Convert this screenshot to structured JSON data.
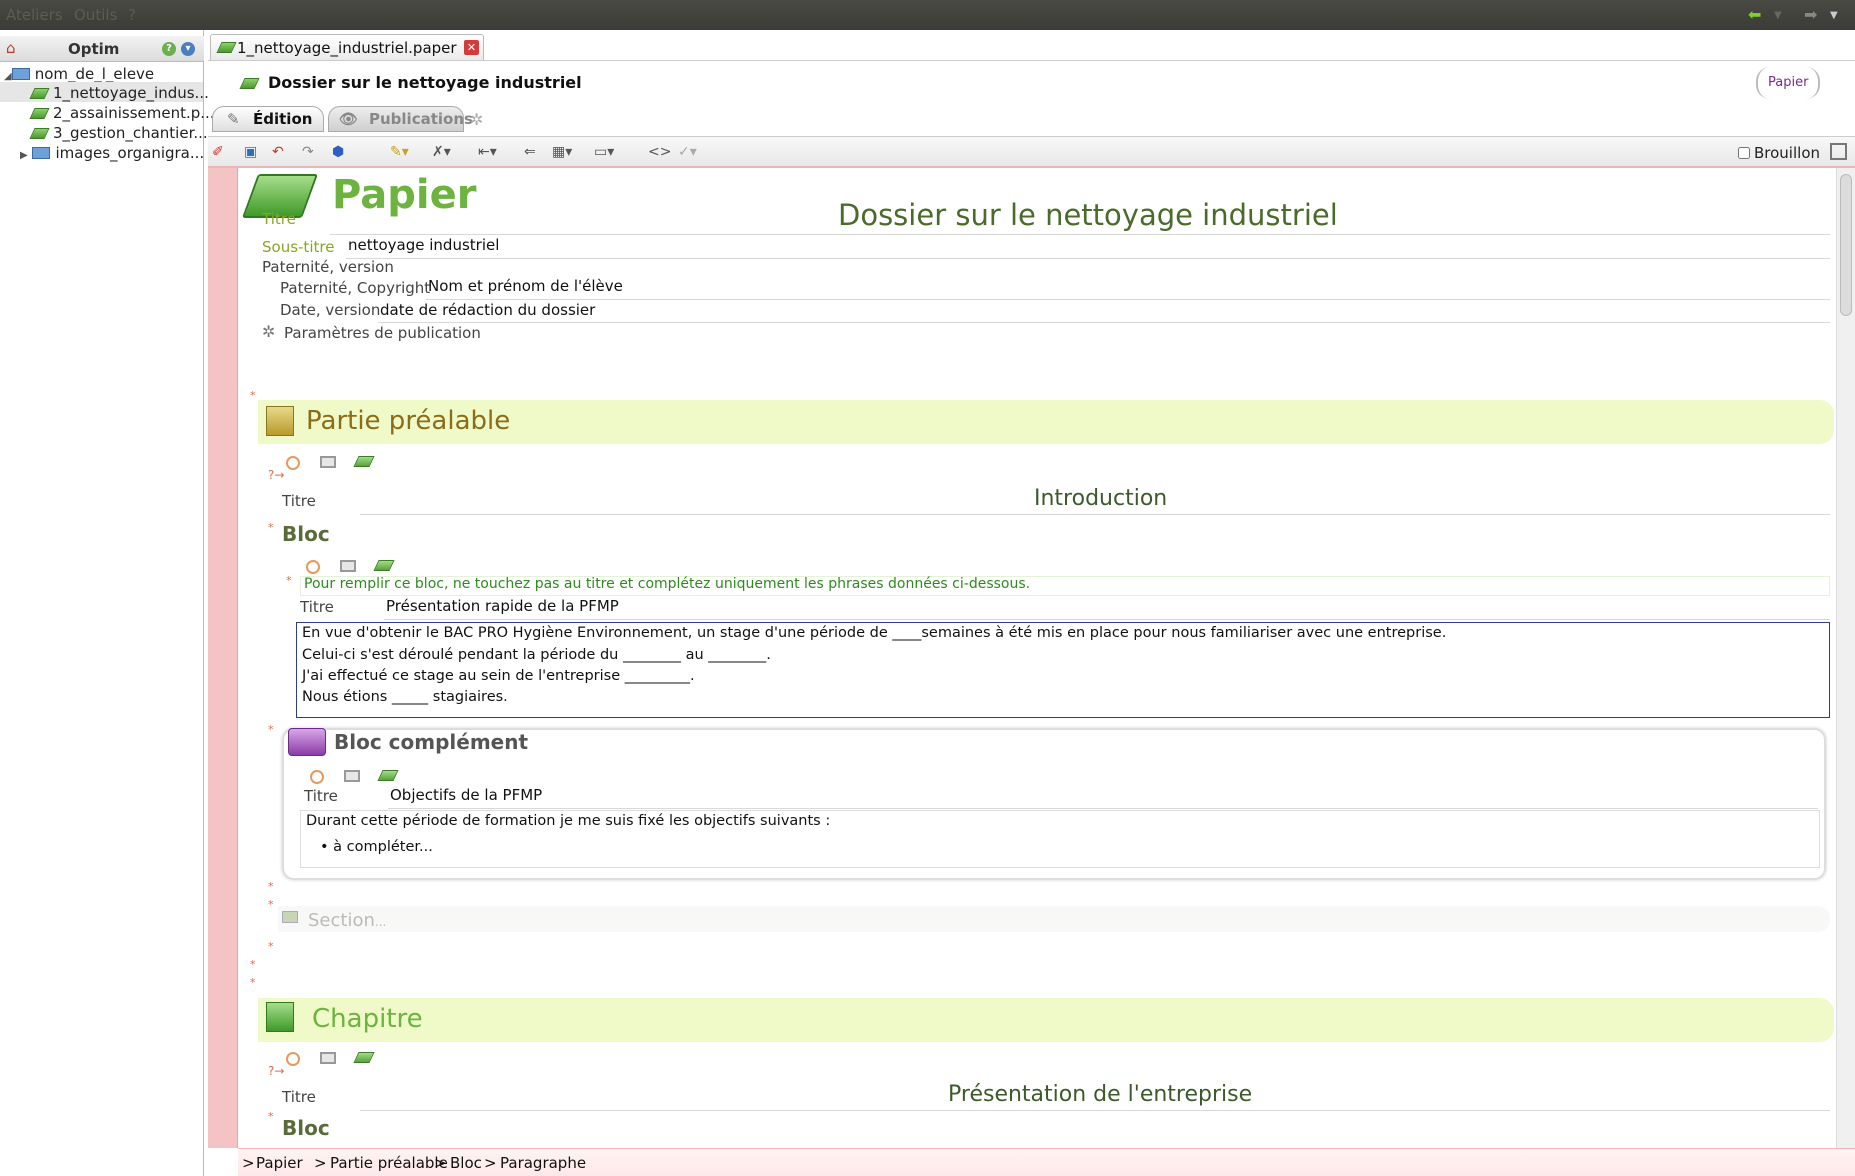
{
  "menu": {
    "items": [
      "Ateliers",
      "Outils",
      "?"
    ]
  },
  "left_panel": {
    "title": "Optim",
    "tree": {
      "root": "nom_de_l_eleve",
      "items": [
        "1_nettoyage_indus...",
        "2_assainissement.p...",
        "3_gestion_chantier....",
        "images_organigra..."
      ]
    }
  },
  "editor": {
    "tab_label": "1_nettoyage_industriel.paper",
    "doc_title": "Dossier sur le nettoyage industriel",
    "badge": "Papier",
    "subtabs": {
      "edition": "Édition",
      "publications": "Publications"
    },
    "brouillon": "Brouillon"
  },
  "doc": {
    "heading": "Papier",
    "titre_label": "Titre",
    "titre_value": "Dossier sur le nettoyage industriel",
    "soustitre_label": "Sous-titre",
    "soustitre_value": "nettoyage industriel",
    "paternite_version_label": "Paternité, version",
    "paternite_label": "Paternité, Copyright",
    "paternite_value": "Nom et prénom de l'élève",
    "date_label": "Date, version",
    "date_value": "date de rédaction du dossier",
    "params_label": "Paramètres de publication",
    "partie": {
      "heading": "Partie préalable",
      "titre_label": "Titre",
      "titre_value": "Introduction",
      "bloc_heading": "Bloc",
      "instruction": "Pour remplir ce bloc, ne touchez pas au titre et complétez uniquement les phrases données ci-dessous.",
      "bloc_titre_label": "Titre",
      "bloc_titre_value": "Présentation rapide de la PFMP",
      "paragraph": [
        "En vue d'obtenir le BAC PRO Hygiène Environnement, un stage d'une période de ____semaines à été mis en place pour nous familiariser avec une entreprise.",
        "Celui-ci s'est déroulé pendant la période du ________ au ________.",
        "J'ai effectué ce stage au sein de l'entreprise _________.",
        "Nous étions _____ stagiaires."
      ],
      "complement_heading": "Bloc complément",
      "comp_titre_label": "Titre",
      "comp_titre_value": "Objectifs de la PFMP",
      "comp_text": "Durant cette période de formation je me suis fixé les objectifs suivants :",
      "comp_bullet": "à compléter...",
      "section_label": "Section",
      "section_dots": "..."
    },
    "chapitre": {
      "heading": "Chapitre",
      "titre_label": "Titre",
      "titre_value": "Présentation de l'entreprise",
      "bloc_heading": "Bloc"
    }
  },
  "breadcrumb": [
    "Papier",
    "Partie préalable",
    "Bloc",
    "Paragraphe"
  ],
  "colors": {
    "green_heading": "#6cb33f",
    "partie_heading": "#8a6d1a",
    "band": "#f0fac8",
    "gutter": "#f4c4c4"
  }
}
